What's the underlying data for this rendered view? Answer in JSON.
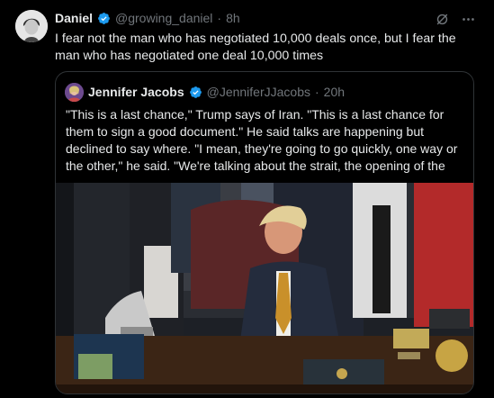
{
  "post": {
    "author_name": "Daniel",
    "handle": "@growing_daniel",
    "separator": "·",
    "time": "8h",
    "text": "I fear not the man who has negotiated 10,000 deals once, but I fear the man who has negotiated one deal 10,000 times"
  },
  "quoted": {
    "author_name": "Jennifer Jacobs",
    "handle": "@JenniferJJacobs",
    "separator": "·",
    "time": "20h",
    "text": "\"This is a last chance,\" Trump says of Iran. \"This is a last chance for them to sign a good document.\" He said talks are happening but declined to say where. \"I mean, they're going to go quickly, one way or the other,\" he said. \"We're talking about the strait, the opening of the"
  },
  "icons": {
    "verified": "verified-badge-icon",
    "grok": "grok-icon",
    "more": "more-icon"
  },
  "colors": {
    "verified": "#1d9bf0",
    "muted": "#71767b",
    "border": "#2f3336"
  }
}
